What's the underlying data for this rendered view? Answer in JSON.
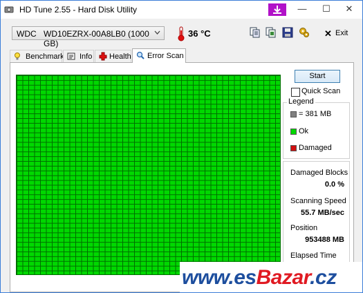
{
  "window": {
    "title": "HD Tune 2.55 - Hard Disk Utility"
  },
  "toolbar": {
    "drive_vendor": "WDC",
    "drive_model": "WD10EZRX-00A8LB0 (1000 GB)",
    "temperature": "36 °C",
    "exit_label": "Exit",
    "icons": [
      "copy-text-icon",
      "copy-screenshot-icon",
      "save-icon",
      "options-icon",
      "exit-icon"
    ]
  },
  "tabs": [
    {
      "label": "Benchmark",
      "icon": "lightbulb-icon"
    },
    {
      "label": "Info",
      "icon": "info-icon"
    },
    {
      "label": "Health",
      "icon": "health-cross-icon"
    },
    {
      "label": "Error Scan",
      "icon": "magnifier-icon",
      "active": true
    }
  ],
  "scan": {
    "start_label": "Start",
    "quick_scan_label": "Quick Scan",
    "quick_scan_checked": false,
    "legend": {
      "title": "Legend",
      "items": [
        {
          "label": "= 381 MB",
          "color": "#808080"
        },
        {
          "label": "Ok",
          "color": "#00d800"
        },
        {
          "label": "Damaged",
          "color": "#d01010"
        }
      ]
    },
    "stats": {
      "damaged_blocks_label": "Damaged Blocks",
      "damaged_blocks_value": "0.0 %",
      "scanning_speed_label": "Scanning Speed",
      "scanning_speed_value": "55.7 MB/sec",
      "position_label": "Position",
      "position_value": "953488 MB",
      "elapsed_time_label": "Elapsed Time"
    },
    "grid_status": "Ok",
    "grid_color": "#00d800"
  },
  "watermark": {
    "prefix": "www.es",
    "brand": "Bazar",
    "suffix": ".cz"
  }
}
